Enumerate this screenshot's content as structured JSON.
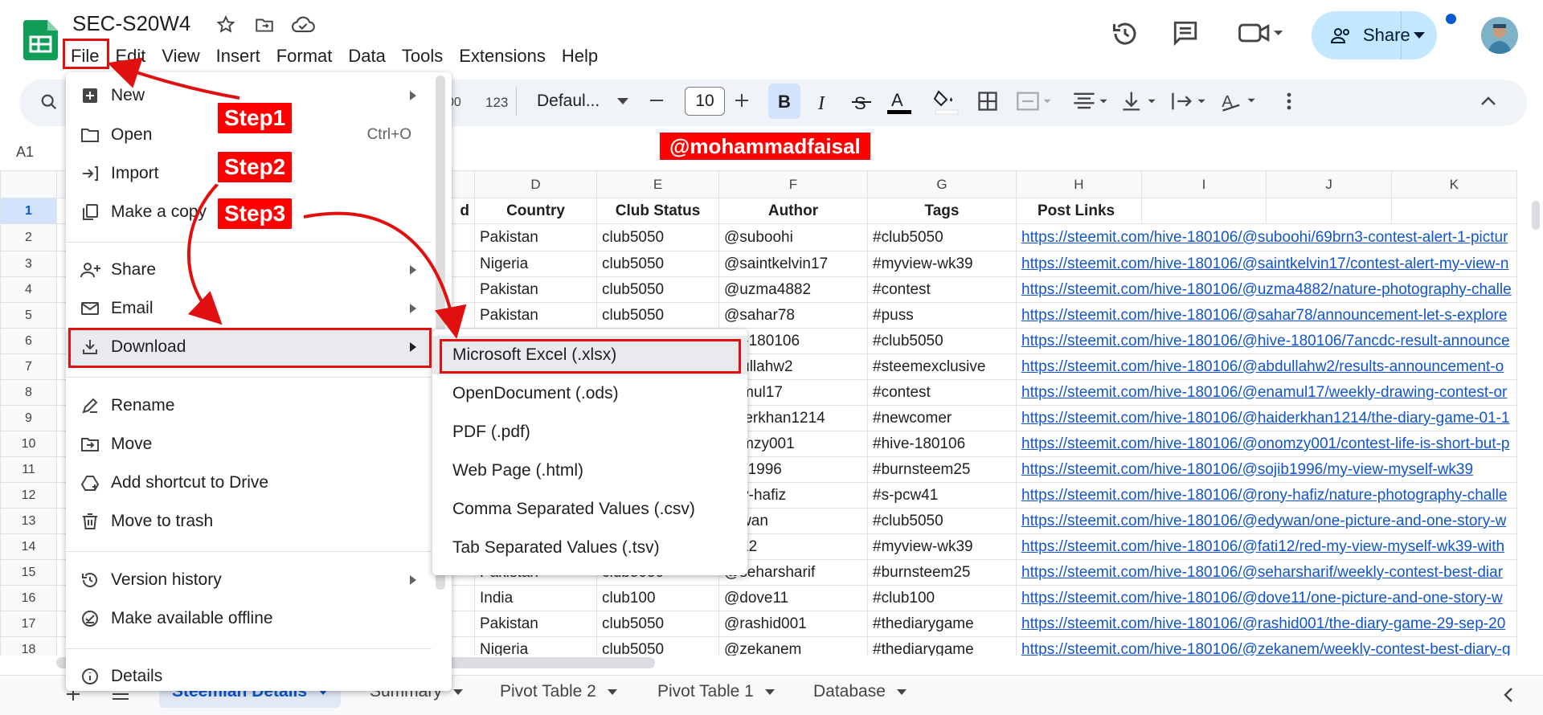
{
  "doc": {
    "title": "SEC-S20W4"
  },
  "menubar": [
    "File",
    "Edit",
    "View",
    "Insert",
    "Format",
    "Data",
    "Tools",
    "Extensions",
    "Help"
  ],
  "share": {
    "label": "Share"
  },
  "toolbar": {
    "number_format": "123",
    "font": "Defaul...",
    "font_size": "10"
  },
  "name_box": "A1",
  "watermark": "@mohammadfaisal",
  "grid": {
    "columns": [
      "D",
      "E",
      "F",
      "G",
      "H",
      "I",
      "J",
      "K"
    ],
    "header_row": [
      "d",
      "Country",
      "Club Status",
      "Author",
      "Tags",
      "Post Links"
    ],
    "row_numbers": [
      "1",
      "2",
      "3",
      "4",
      "5",
      "6",
      "7",
      "8",
      "9",
      "10",
      "11",
      "12",
      "13",
      "14",
      "15",
      "16",
      "17",
      "18"
    ],
    "rows": [
      [
        "",
        "Pakistan",
        "club5050",
        "@suboohi",
        "#club5050",
        "https://steemit.com/hive-180106/@suboohi/69brn3-contest-alert-1-pictur"
      ],
      [
        "",
        "Nigeria",
        "club5050",
        "@saintkelvin17",
        "#myview-wk39",
        "https://steemit.com/hive-180106/@saintkelvin17/contest-alert-my-view-n"
      ],
      [
        "",
        "Pakistan",
        "club5050",
        "@uzma4882",
        "#contest",
        "https://steemit.com/hive-180106/@uzma4882/nature-photography-challe"
      ],
      [
        "",
        "Pakistan",
        "club5050",
        "@sahar78",
        "#puss",
        "https://steemit.com/hive-180106/@sahar78/announcement-let-s-explore"
      ],
      [
        "",
        "",
        "",
        "ive-180106",
        "#club5050",
        "https://steemit.com/hive-180106/@hive-180106/7ancdc-result-announce"
      ],
      [
        "",
        "",
        "",
        "bdullahw2",
        "#steemexclusive",
        "https://steemit.com/hive-180106/@abdullahw2/results-announcement-o"
      ],
      [
        "",
        "",
        "",
        "namul17",
        "#contest",
        "https://steemit.com/hive-180106/@enamul17/weekly-drawing-contest-or"
      ],
      [
        "",
        "",
        "",
        "aiderkhan1214",
        "#newcomer",
        "https://steemit.com/hive-180106/@haiderkhan1214/the-diary-game-01-1"
      ],
      [
        "",
        "",
        "",
        "nomzy001",
        "#hive-180106",
        "https://steemit.com/hive-180106/@onomzy001/contest-life-is-short-but-p"
      ],
      [
        "",
        "",
        "",
        "ojib1996",
        "#burnsteem25",
        "https://steemit.com/hive-180106/@sojib1996/my-view-myself-wk39"
      ],
      [
        "",
        "",
        "",
        "ony-hafiz",
        "#s-pcw41",
        "https://steemit.com/hive-180106/@rony-hafiz/nature-photography-challe"
      ],
      [
        "",
        "",
        "",
        "dywan",
        "#club5050",
        "https://steemit.com/hive-180106/@edywan/one-picture-and-one-story-w"
      ],
      [
        "",
        "",
        "",
        "ati12",
        "#myview-wk39",
        "https://steemit.com/hive-180106/@fati12/red-my-view-myself-wk39-with"
      ],
      [
        "",
        "Pakistan",
        "club5050",
        "@seharsharif",
        "#burnsteem25",
        "https://steemit.com/hive-180106/@seharsharif/weekly-contest-best-diar"
      ],
      [
        "",
        "India",
        "club100",
        "@dove11",
        "#club100",
        "https://steemit.com/hive-180106/@dove11/one-picture-and-one-story-w"
      ],
      [
        "",
        "Pakistan",
        "club5050",
        "@rashid001",
        "#thediarygame",
        "https://steemit.com/hive-180106/@rashid001/the-diary-game-29-sep-20"
      ],
      [
        "",
        "Nigeria",
        "club5050",
        "@zekanem",
        "#thediarygame",
        "https://steemit.com/hive-180106/@zekanem/weekly-contest-best-diary-g"
      ]
    ]
  },
  "file_menu": {
    "items": [
      {
        "label": "New",
        "icon": "new-icon",
        "submenu": true
      },
      {
        "label": "Open",
        "icon": "folder-icon",
        "shortcut": "Ctrl+O"
      },
      {
        "label": "Import",
        "icon": "import-icon"
      },
      {
        "label": "Make a copy",
        "icon": "copy-icon"
      },
      {
        "label": "Share",
        "icon": "share-person-icon",
        "submenu": true
      },
      {
        "label": "Email",
        "icon": "email-icon",
        "submenu": true
      },
      {
        "label": "Download",
        "icon": "download-icon",
        "submenu": true
      },
      {
        "label": "Rename",
        "icon": "rename-icon"
      },
      {
        "label": "Move",
        "icon": "move-icon"
      },
      {
        "label": "Add shortcut to Drive",
        "icon": "add-shortcut-icon"
      },
      {
        "label": "Move to trash",
        "icon": "trash-icon"
      },
      {
        "label": "Version history",
        "icon": "history-icon",
        "submenu": true
      },
      {
        "label": "Make available offline",
        "icon": "offline-icon"
      },
      {
        "label": "Details",
        "icon": "info-icon"
      }
    ]
  },
  "download_menu": {
    "items": [
      "Microsoft Excel (.xlsx)",
      "OpenDocument (.ods)",
      "PDF (.pdf)",
      "Web Page (.html)",
      "Comma Separated Values (.csv)",
      "Tab Separated Values (.tsv)"
    ]
  },
  "annotations": {
    "step1": "Step1",
    "step2": "Step2",
    "step3": "Step3",
    "color": "#ff0000"
  },
  "sheet_tabs": [
    "Steemian Details",
    "Summary",
    "Pivot Table 2",
    "Pivot Table 1",
    "Database"
  ],
  "colors": {
    "accent": "#0b57d0",
    "link": "#1155cc",
    "share_bg": "#c2e7ff",
    "sheets_green": "#0f9d58"
  }
}
